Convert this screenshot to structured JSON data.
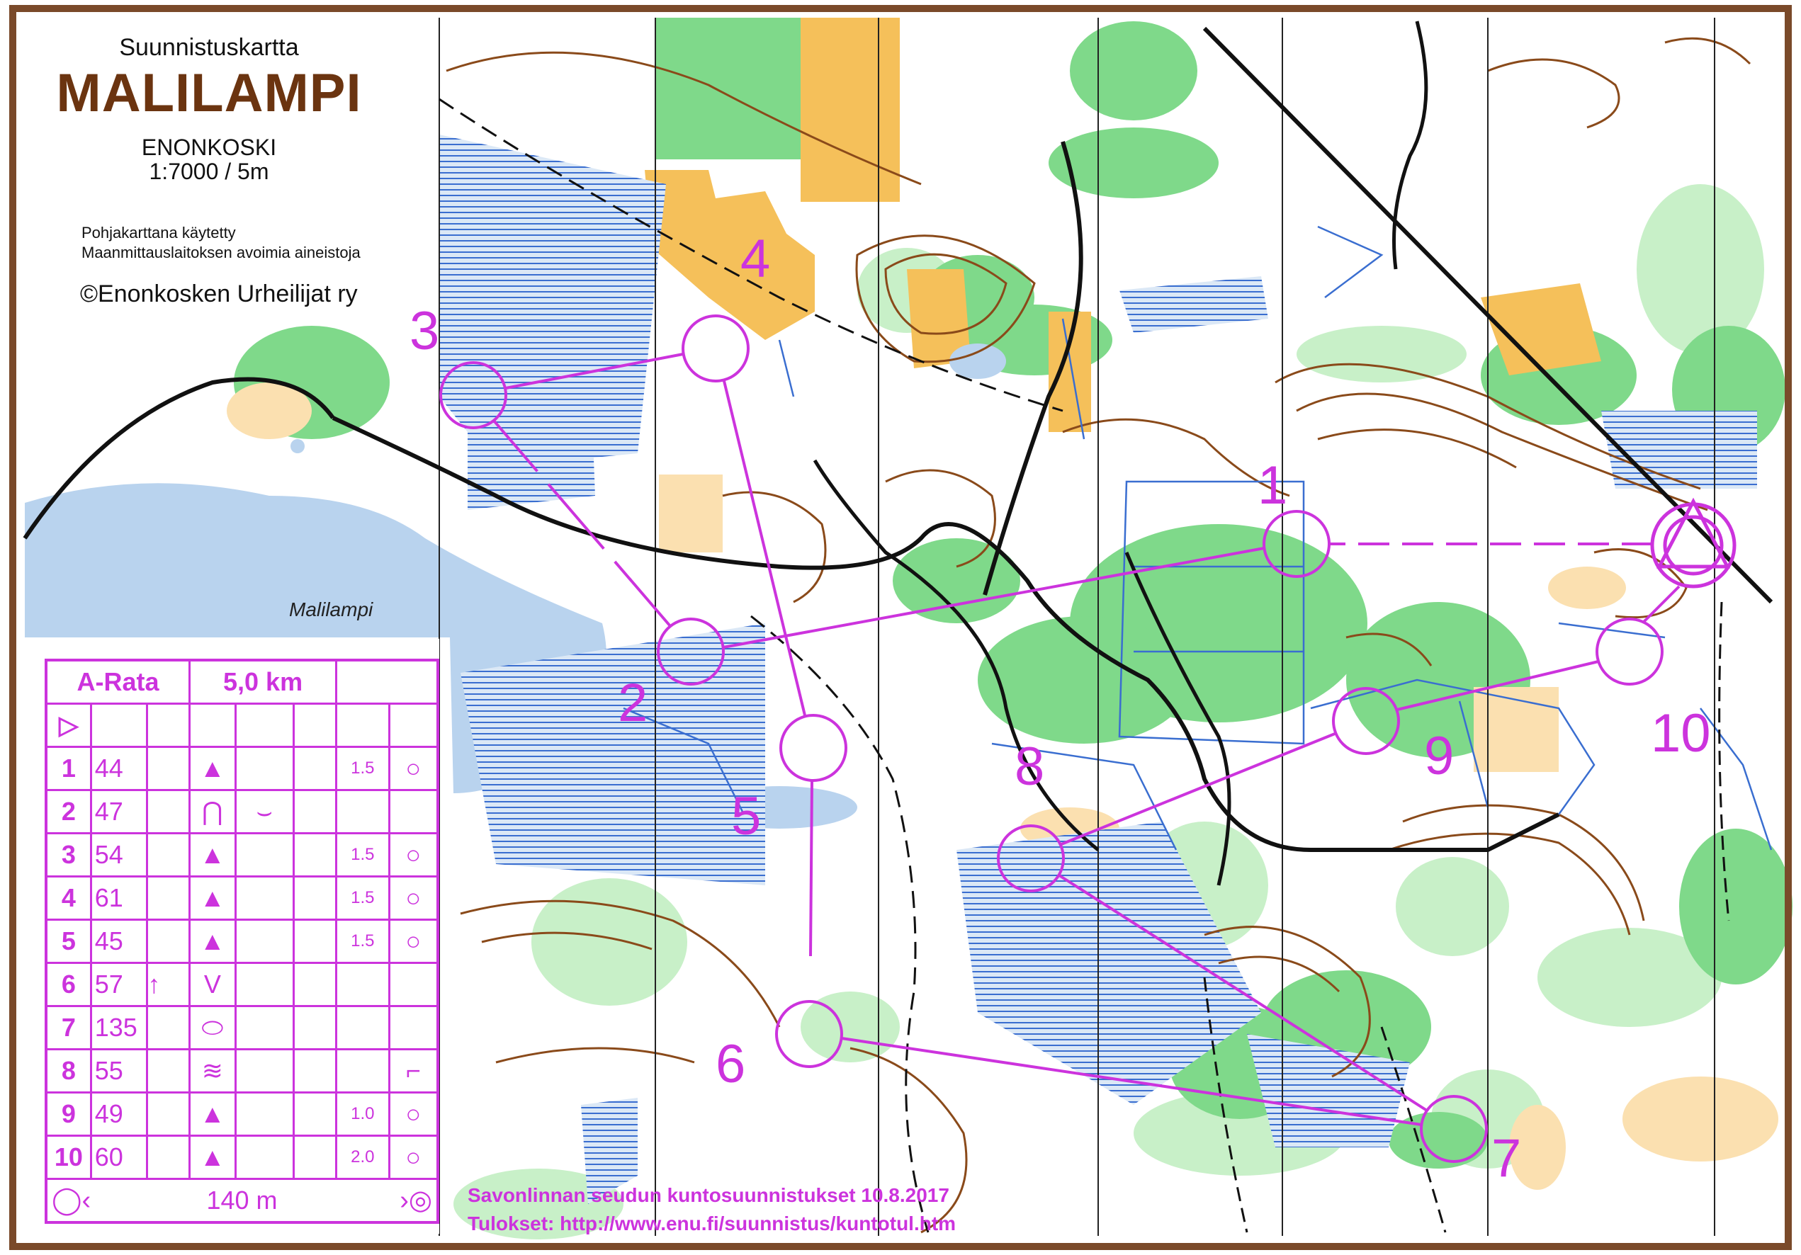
{
  "header": {
    "map_type": "Suunnistuskartta",
    "map_name": "MALILAMPI",
    "location": "ENONKOSKI",
    "scale": "1:7000 / 5m",
    "credit_line1": "Pohjakarttana käytetty",
    "credit_line2": "Maanmittauslaitoksen avoimia aineistoja",
    "copyright": "©Enonkosken Urheilijat ry"
  },
  "lake_label": "Malilampi",
  "course": {
    "name": "A-Rata",
    "length": "5,0 km",
    "start_symbol": "▷",
    "controls": [
      {
        "num": "1",
        "code": "44",
        "c": "",
        "feature": "▲",
        "appearance": "",
        "dims": "1.5",
        "location": "○"
      },
      {
        "num": "2",
        "code": "47",
        "c": "",
        "feature": "⋂",
        "appearance": "⌣",
        "dims": "",
        "location": ""
      },
      {
        "num": "3",
        "code": "54",
        "c": "",
        "feature": "▲",
        "appearance": "",
        "dims": "1.5",
        "location": "○"
      },
      {
        "num": "4",
        "code": "61",
        "c": "",
        "feature": "▲",
        "appearance": "",
        "dims": "1.5",
        "location": "○"
      },
      {
        "num": "5",
        "code": "45",
        "c": "",
        "feature": "▲",
        "appearance": "",
        "dims": "1.5",
        "location": "○"
      },
      {
        "num": "6",
        "code": "57",
        "c": "↑",
        "feature": "V",
        "appearance": "",
        "dims": "",
        "location": ""
      },
      {
        "num": "7",
        "code": "135",
        "c": "",
        "feature": "⬭",
        "appearance": "",
        "dims": "",
        "location": ""
      },
      {
        "num": "8",
        "code": "55",
        "c": "",
        "feature": "≋",
        "appearance": "",
        "dims": "",
        "location": "⌐"
      },
      {
        "num": "9",
        "code": "49",
        "c": "",
        "feature": "▲",
        "appearance": "",
        "dims": "1.0",
        "location": "○"
      },
      {
        "num": "10",
        "code": "60",
        "c": "",
        "feature": "▲",
        "appearance": "",
        "dims": "2.0",
        "location": "○"
      }
    ],
    "finish_distance": "140 m"
  },
  "control_labels": [
    "1",
    "2",
    "3",
    "4",
    "5",
    "6",
    "7",
    "8",
    "9",
    "10"
  ],
  "footer": {
    "line1": "Savonlinnan seudun kuntosuunnistukset 10.8.2017",
    "line2": "Tulokset: http://www.enu.fi/suunnistus/kuntotul.htm"
  },
  "colors": {
    "course": "#cc33dd",
    "water": "#b9d3ee",
    "forest_green": "#7fd98a",
    "light_green": "#c8f0c8",
    "open_yellow": "#f5c05a",
    "contour_brown": "#8a4a1a",
    "frame_brown": "#7a4a2a"
  }
}
